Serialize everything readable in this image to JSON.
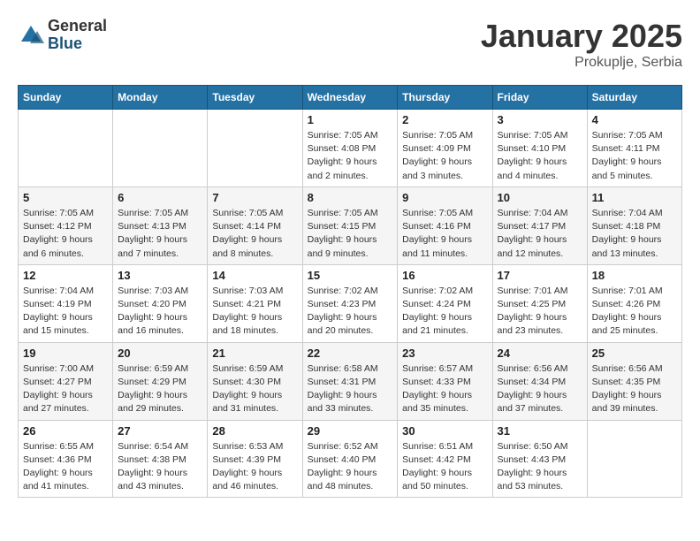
{
  "logo": {
    "general": "General",
    "blue": "Blue"
  },
  "title": "January 2025",
  "subtitle": "Prokuplje, Serbia",
  "days_of_week": [
    "Sunday",
    "Monday",
    "Tuesday",
    "Wednesday",
    "Thursday",
    "Friday",
    "Saturday"
  ],
  "weeks": [
    [
      {
        "day": "",
        "info": ""
      },
      {
        "day": "",
        "info": ""
      },
      {
        "day": "",
        "info": ""
      },
      {
        "day": "1",
        "info": "Sunrise: 7:05 AM\nSunset: 4:08 PM\nDaylight: 9 hours and 2 minutes."
      },
      {
        "day": "2",
        "info": "Sunrise: 7:05 AM\nSunset: 4:09 PM\nDaylight: 9 hours and 3 minutes."
      },
      {
        "day": "3",
        "info": "Sunrise: 7:05 AM\nSunset: 4:10 PM\nDaylight: 9 hours and 4 minutes."
      },
      {
        "day": "4",
        "info": "Sunrise: 7:05 AM\nSunset: 4:11 PM\nDaylight: 9 hours and 5 minutes."
      }
    ],
    [
      {
        "day": "5",
        "info": "Sunrise: 7:05 AM\nSunset: 4:12 PM\nDaylight: 9 hours and 6 minutes."
      },
      {
        "day": "6",
        "info": "Sunrise: 7:05 AM\nSunset: 4:13 PM\nDaylight: 9 hours and 7 minutes."
      },
      {
        "day": "7",
        "info": "Sunrise: 7:05 AM\nSunset: 4:14 PM\nDaylight: 9 hours and 8 minutes."
      },
      {
        "day": "8",
        "info": "Sunrise: 7:05 AM\nSunset: 4:15 PM\nDaylight: 9 hours and 9 minutes."
      },
      {
        "day": "9",
        "info": "Sunrise: 7:05 AM\nSunset: 4:16 PM\nDaylight: 9 hours and 11 minutes."
      },
      {
        "day": "10",
        "info": "Sunrise: 7:04 AM\nSunset: 4:17 PM\nDaylight: 9 hours and 12 minutes."
      },
      {
        "day": "11",
        "info": "Sunrise: 7:04 AM\nSunset: 4:18 PM\nDaylight: 9 hours and 13 minutes."
      }
    ],
    [
      {
        "day": "12",
        "info": "Sunrise: 7:04 AM\nSunset: 4:19 PM\nDaylight: 9 hours and 15 minutes."
      },
      {
        "day": "13",
        "info": "Sunrise: 7:03 AM\nSunset: 4:20 PM\nDaylight: 9 hours and 16 minutes."
      },
      {
        "day": "14",
        "info": "Sunrise: 7:03 AM\nSunset: 4:21 PM\nDaylight: 9 hours and 18 minutes."
      },
      {
        "day": "15",
        "info": "Sunrise: 7:02 AM\nSunset: 4:23 PM\nDaylight: 9 hours and 20 minutes."
      },
      {
        "day": "16",
        "info": "Sunrise: 7:02 AM\nSunset: 4:24 PM\nDaylight: 9 hours and 21 minutes."
      },
      {
        "day": "17",
        "info": "Sunrise: 7:01 AM\nSunset: 4:25 PM\nDaylight: 9 hours and 23 minutes."
      },
      {
        "day": "18",
        "info": "Sunrise: 7:01 AM\nSunset: 4:26 PM\nDaylight: 9 hours and 25 minutes."
      }
    ],
    [
      {
        "day": "19",
        "info": "Sunrise: 7:00 AM\nSunset: 4:27 PM\nDaylight: 9 hours and 27 minutes."
      },
      {
        "day": "20",
        "info": "Sunrise: 6:59 AM\nSunset: 4:29 PM\nDaylight: 9 hours and 29 minutes."
      },
      {
        "day": "21",
        "info": "Sunrise: 6:59 AM\nSunset: 4:30 PM\nDaylight: 9 hours and 31 minutes."
      },
      {
        "day": "22",
        "info": "Sunrise: 6:58 AM\nSunset: 4:31 PM\nDaylight: 9 hours and 33 minutes."
      },
      {
        "day": "23",
        "info": "Sunrise: 6:57 AM\nSunset: 4:33 PM\nDaylight: 9 hours and 35 minutes."
      },
      {
        "day": "24",
        "info": "Sunrise: 6:56 AM\nSunset: 4:34 PM\nDaylight: 9 hours and 37 minutes."
      },
      {
        "day": "25",
        "info": "Sunrise: 6:56 AM\nSunset: 4:35 PM\nDaylight: 9 hours and 39 minutes."
      }
    ],
    [
      {
        "day": "26",
        "info": "Sunrise: 6:55 AM\nSunset: 4:36 PM\nDaylight: 9 hours and 41 minutes."
      },
      {
        "day": "27",
        "info": "Sunrise: 6:54 AM\nSunset: 4:38 PM\nDaylight: 9 hours and 43 minutes."
      },
      {
        "day": "28",
        "info": "Sunrise: 6:53 AM\nSunset: 4:39 PM\nDaylight: 9 hours and 46 minutes."
      },
      {
        "day": "29",
        "info": "Sunrise: 6:52 AM\nSunset: 4:40 PM\nDaylight: 9 hours and 48 minutes."
      },
      {
        "day": "30",
        "info": "Sunrise: 6:51 AM\nSunset: 4:42 PM\nDaylight: 9 hours and 50 minutes."
      },
      {
        "day": "31",
        "info": "Sunrise: 6:50 AM\nSunset: 4:43 PM\nDaylight: 9 hours and 53 minutes."
      },
      {
        "day": "",
        "info": ""
      }
    ]
  ]
}
